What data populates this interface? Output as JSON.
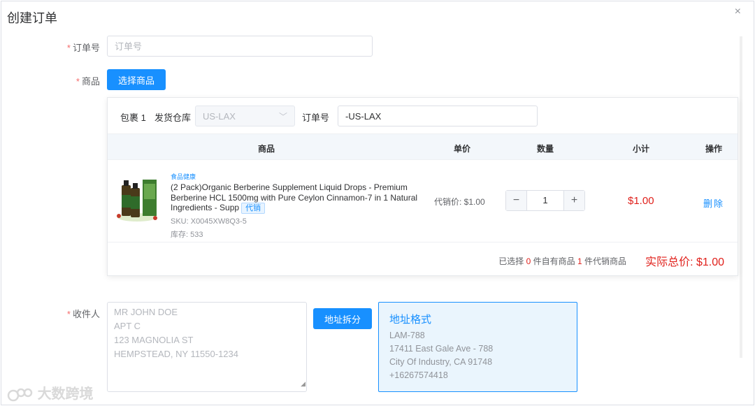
{
  "dialog": {
    "title": "创建订单",
    "close_glyph": "×"
  },
  "order_field": {
    "label": "订单号",
    "placeholder": "订单号",
    "value": ""
  },
  "goods_field": {
    "label": "商品",
    "select_button": "选择商品"
  },
  "package": {
    "name": "包裹 1",
    "warehouse_label": "发货仓库",
    "warehouse_value": "US-LAX",
    "order_no_label": "订单号",
    "order_no_value": "-US-LAX"
  },
  "table": {
    "headers": {
      "goods": "商品",
      "unit_price": "单价",
      "qty": "数量",
      "subtotal": "小计",
      "action": "操作"
    },
    "rows": [
      {
        "category": "食品健康",
        "name": "(2 Pack)Organic Berberine Supplement Liquid Drops - Premium Berberine HCL 1500mg with Pure Ceylon Cinnamon-7 in 1 Natural Ingredients - Supp",
        "badge": "代销",
        "sku": "SKU: X0045XW8Q3-5",
        "stock": "库存: 533",
        "price": "代销价: $1.00",
        "qty": "1",
        "subtotal": "$1.00",
        "delete": "删除"
      }
    ]
  },
  "summary": {
    "prefix": "已选择",
    "own_count": "0",
    "own_text": "件自有商品",
    "consign_count": "1",
    "consign_text": "件代销商品",
    "total": "实际总价: $1.00"
  },
  "recipient": {
    "label": "收件人",
    "address_lines": [
      "MR JOHN DOE",
      "APT C",
      "123 MAGNOLIA ST",
      "HEMPSTEAD, NY 11550-1234"
    ],
    "split_button": "地址拆分"
  },
  "address_format": {
    "title": "地址格式",
    "lines": [
      "LAM-788",
      "17411 East Gale Ave - 788",
      "City Of Industry, CA 91748",
      "+16267574418"
    ]
  },
  "watermark": {
    "text": "大数跨境"
  },
  "colors": {
    "primary": "#1890ff",
    "price_red": "#e0201b",
    "required": "#f56c6c"
  }
}
